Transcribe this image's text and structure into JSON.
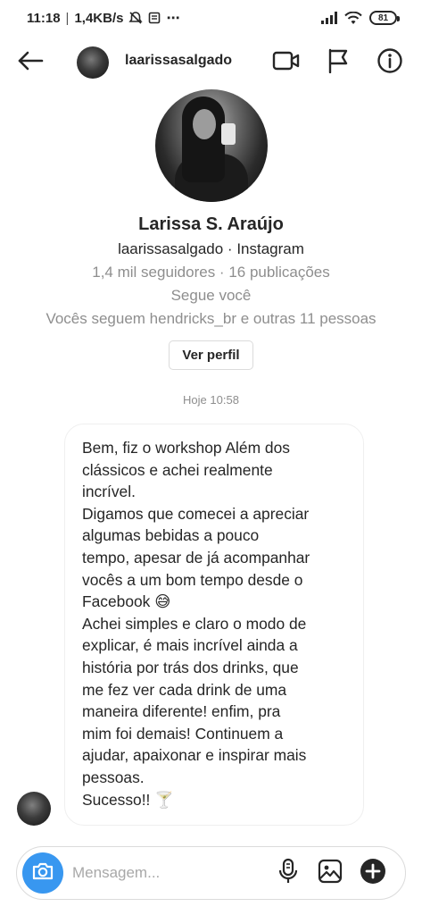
{
  "status_bar": {
    "time": "11:18",
    "separator": "|",
    "network_speed": "1,4KB/s",
    "more": "⋯",
    "battery": "81"
  },
  "header": {
    "username": "laarissasalgado"
  },
  "profile": {
    "full_name": "Larissa S. Araújo",
    "handle_line": "laarissasalgado · Instagram",
    "stats": "1,4 mil seguidores · 16 publicações",
    "follows_you": "Segue você",
    "mutuals": "Vocês seguem hendricks_br e outras 11 pessoas",
    "view_profile_label": "Ver perfil"
  },
  "conversation": {
    "timestamp": "Hoje 10:58",
    "message": "Bem, fiz o workshop Além dos\nclássicos e achei realmente\nincrível.\nDigamos que comecei a apreciar\nalgumas bebidas a pouco\ntempo, apesar de já acompanhar\nvocês a um bom tempo desde o\nFacebook 😅\nAchei simples e claro o modo de\nexplicar, é mais incrível ainda a\nhistória por trás dos drinks, que\nme fez ver cada drink de uma\nmaneira diferente! enfim, pra\nmim foi demais! Continuem a\najudar, apaixonar e inspirar mais\npessoas.\nSucesso!! 🍸"
  },
  "composer": {
    "placeholder": "Mensagem..."
  },
  "icons": {
    "back": "arrow-left-icon",
    "video": "video-camera-icon",
    "report": "flag-icon",
    "info": "info-icon",
    "camera": "camera-icon",
    "mic": "microphone-icon",
    "gallery": "image-icon",
    "add": "plus-circle-icon"
  },
  "colors": {
    "accent": "#3897f0",
    "text": "#262626",
    "muted": "#8e8e8e",
    "border": "#dbdbdb"
  }
}
